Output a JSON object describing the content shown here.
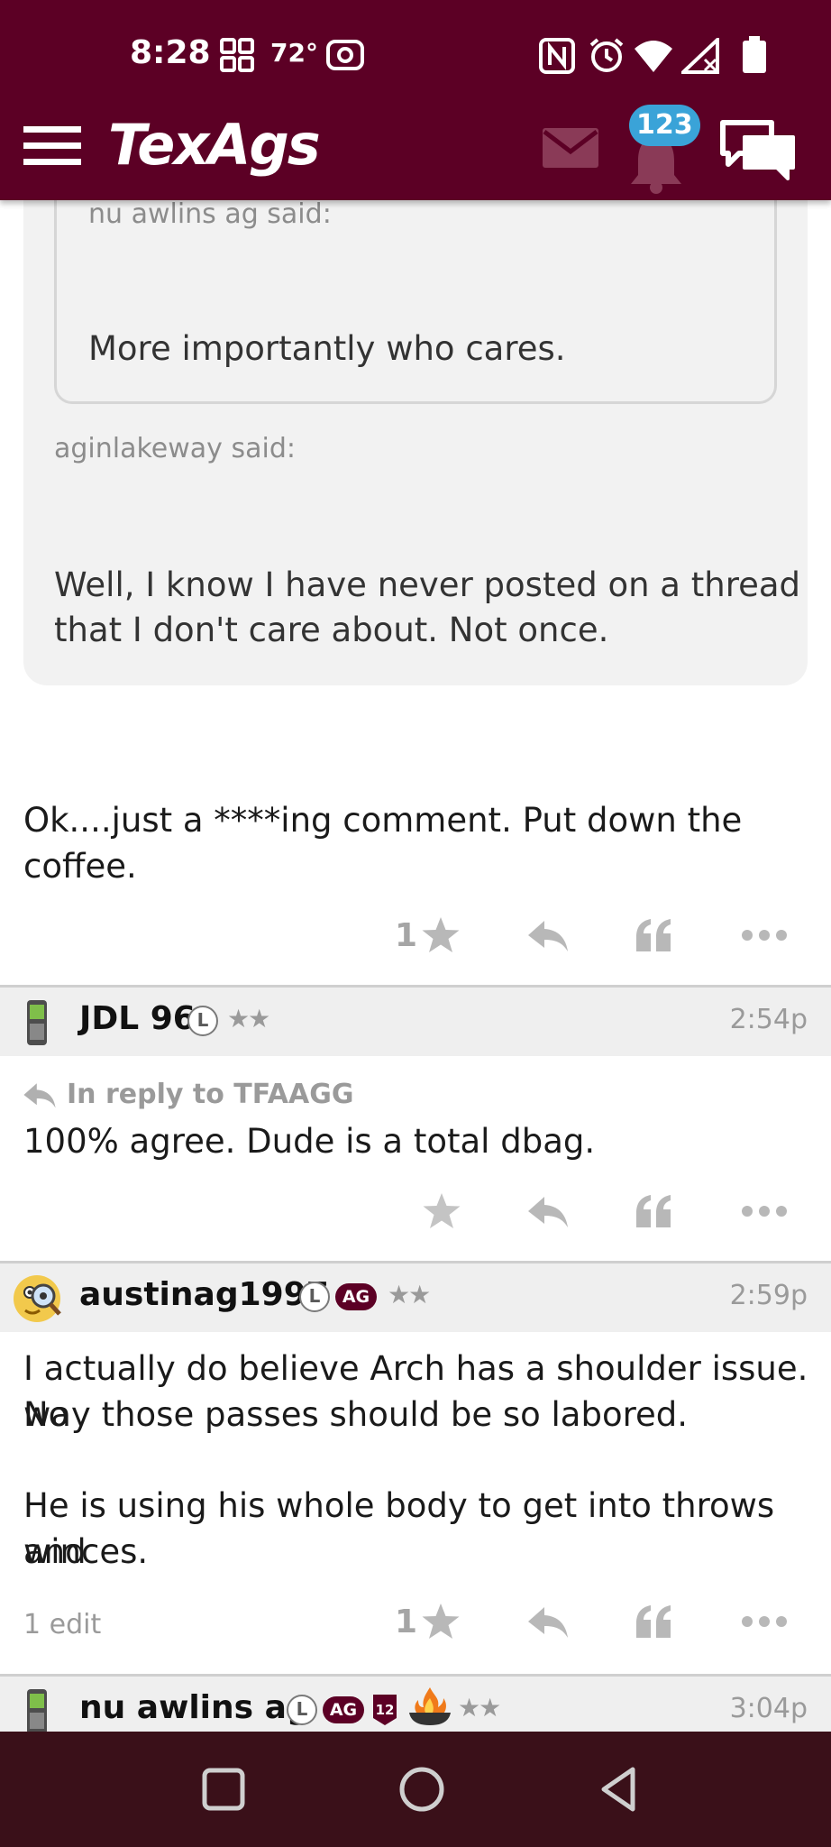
{
  "status_bar": {
    "time": "8:28",
    "temperature": "72°"
  },
  "app_bar": {
    "logo": "TexAgs",
    "notification_count": "123",
    "colors": {
      "brand": "#5c0025",
      "badge": "#3aa3d8"
    }
  },
  "quote": {
    "nested_author": "nu awlins ag said:",
    "nested_text": "More importantly who cares.",
    "author": "aginlakeway said:",
    "text_line1": "Well, I know I have never posted on a thread",
    "text_line2": "that I don't care about. Not once."
  },
  "posts": [
    {
      "body_line1": "Ok....just a ****ing comment. Put down the",
      "body_line2": "coffee.",
      "star_count": "1"
    },
    {
      "username": "JDL 96",
      "badge_l": "L",
      "stars": "★★",
      "time": "2:54p",
      "reply_to": "In reply to TFAAGG",
      "body_line1": "100% agree. Dude is a total dbag."
    },
    {
      "username": "austinag1997",
      "badge_l": "L",
      "badge_ag": "AG",
      "stars": "★★",
      "time": "2:59p",
      "body_line1": "I actually do believe Arch has a shoulder issue. No",
      "body_line2": "way those passes should be so labored.",
      "body_line3": "He is using his whole body to get into throws and",
      "body_line4": "winces.",
      "edit_note": "1 edit",
      "star_count": "1"
    },
    {
      "username": "nu awlins ag",
      "badge_l": "L",
      "badge_ag": "AG",
      "stars": "★★",
      "time": "3:04p"
    }
  ]
}
